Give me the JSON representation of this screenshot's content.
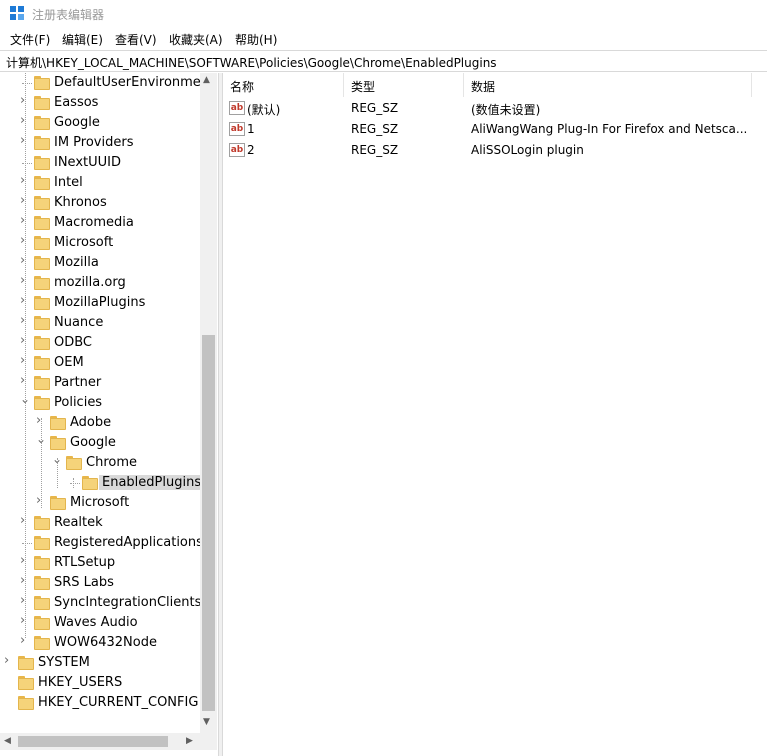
{
  "window": {
    "title": "注册表编辑器"
  },
  "menu": [
    "文件(F)",
    "编辑(E)",
    "查看(V)",
    "收藏夹(A)",
    "帮助(H)"
  ],
  "address": "计算机\\HKEY_LOCAL_MACHINE\\SOFTWARE\\Policies\\Google\\Chrome\\EnabledPlugins",
  "tree": [
    {
      "label": "DefaultUserEnvironment",
      "level": 2,
      "chevron": ""
    },
    {
      "label": "Eassos",
      "level": 2,
      "chevron": ">"
    },
    {
      "label": "Google",
      "level": 2,
      "chevron": ">"
    },
    {
      "label": "IM Providers",
      "level": 2,
      "chevron": ">"
    },
    {
      "label": "INextUUID",
      "level": 2,
      "chevron": ""
    },
    {
      "label": "Intel",
      "level": 2,
      "chevron": ">"
    },
    {
      "label": "Khronos",
      "level": 2,
      "chevron": ">"
    },
    {
      "label": "Macromedia",
      "level": 2,
      "chevron": ">"
    },
    {
      "label": "Microsoft",
      "level": 2,
      "chevron": ">"
    },
    {
      "label": "Mozilla",
      "level": 2,
      "chevron": ">"
    },
    {
      "label": "mozilla.org",
      "level": 2,
      "chevron": ">"
    },
    {
      "label": "MozillaPlugins",
      "level": 2,
      "chevron": ">"
    },
    {
      "label": "Nuance",
      "level": 2,
      "chevron": ">"
    },
    {
      "label": "ODBC",
      "level": 2,
      "chevron": ">"
    },
    {
      "label": "OEM",
      "level": 2,
      "chevron": ">"
    },
    {
      "label": "Partner",
      "level": 2,
      "chevron": ">"
    },
    {
      "label": "Policies",
      "level": 2,
      "chevron": "v"
    },
    {
      "label": "Adobe",
      "level": 3,
      "chevron": ">"
    },
    {
      "label": "Google",
      "level": 3,
      "chevron": "v"
    },
    {
      "label": "Chrome",
      "level": 4,
      "chevron": "v"
    },
    {
      "label": "EnabledPlugins",
      "level": 5,
      "chevron": "",
      "selected": true
    },
    {
      "label": "Microsoft",
      "level": 3,
      "chevron": ">"
    },
    {
      "label": "Realtek",
      "level": 2,
      "chevron": ">"
    },
    {
      "label": "RegisteredApplications",
      "level": 2,
      "chevron": ""
    },
    {
      "label": "RTLSetup",
      "level": 2,
      "chevron": ">"
    },
    {
      "label": "SRS Labs",
      "level": 2,
      "chevron": ">"
    },
    {
      "label": "SyncIntegrationClients",
      "level": 2,
      "chevron": ">"
    },
    {
      "label": "Waves Audio",
      "level": 2,
      "chevron": ">"
    },
    {
      "label": "WOW6432Node",
      "level": 2,
      "chevron": ">"
    },
    {
      "label": "SYSTEM",
      "level": 1,
      "chevron": ">"
    },
    {
      "label": "HKEY_USERS",
      "level": 0,
      "chevron": ""
    },
    {
      "label": "HKEY_CURRENT_CONFIG",
      "level": 0,
      "chevron": ""
    }
  ],
  "list": {
    "headers": [
      "名称",
      "类型",
      "数据"
    ],
    "rows": [
      {
        "icon": "ab",
        "name": "(默认)",
        "type": "REG_SZ",
        "data": "(数值未设置)"
      },
      {
        "icon": "ab",
        "name": "1",
        "type": "REG_SZ",
        "data": "AliWangWang Plug-In For Firefox and Netsca..."
      },
      {
        "icon": "ab",
        "name": "2",
        "type": "REG_SZ",
        "data": "AliSSOLogin plugin"
      }
    ]
  },
  "colors": {
    "accent": "#1e7ad6",
    "folder": "#f5d37a",
    "selection": "#d9d9d9"
  }
}
